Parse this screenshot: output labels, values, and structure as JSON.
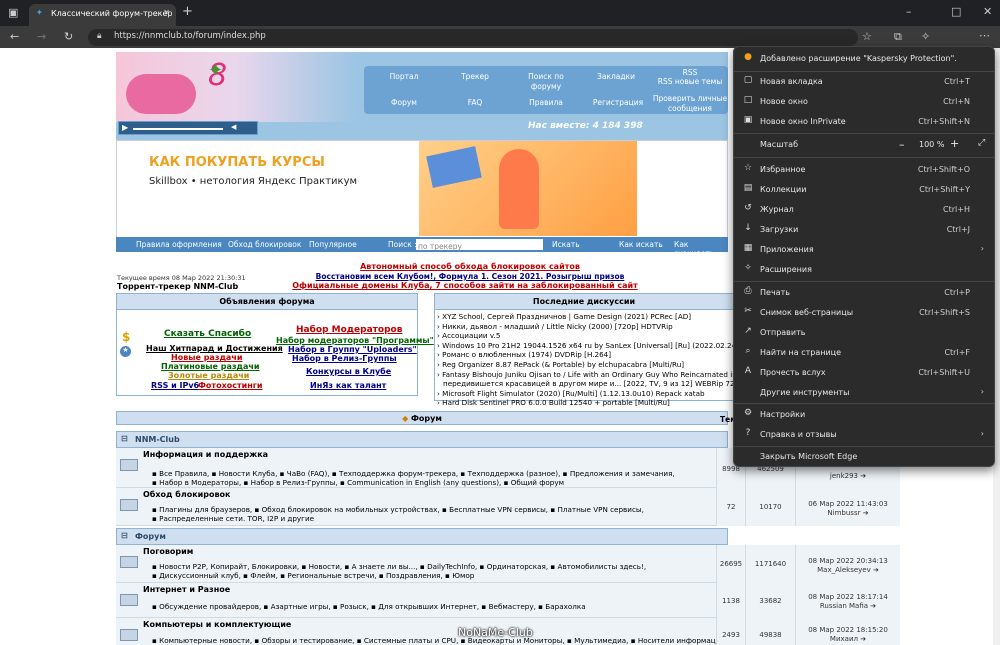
{
  "browser": {
    "tab_title": "Классический форум-трекер :: ",
    "url": "https://nnmclub.to/forum/index.php"
  },
  "site": {
    "nav_top": [
      "Портал",
      "Трекер",
      "Поиск по форуму",
      "Закладки",
      "RSS",
      "RSS новые темы"
    ],
    "nav_bottom": [
      "Форум",
      "FAQ",
      "Правила",
      "Регистрация",
      "Проверить личные сообщения"
    ],
    "online": "Нас вместе: 4 184 398",
    "ad_heading": "КАК ПОКУПАТЬ КУРСЫ",
    "ad_brands": "Skillbox   • нетология   Яндекс Практикум",
    "subnav": {
      "rules": "Правила оформления",
      "bypass": "Обход блокировок",
      "popular": "Популярное",
      "search_label": "Поиск :",
      "search_placeholder": "по трекеру",
      "search_btn": "Искать",
      "how_search": "Как искать",
      "how_download": "Как скачивать"
    },
    "time": "Текущее время 08 Мар 2022 21:30:31",
    "tracker_title": "Торрент-трекер NNM-Club",
    "announce": [
      "Автономный способ обхода блокировок сайтов",
      "Восстановим всем Клубом!, Формула 1. Сезон 2021. Розыгрыш призов",
      "Официальные домены Клуба, 7 способов зайти на заблокированный сайт"
    ],
    "announcements": {
      "title": "Объявления форума",
      "left": [
        "Сказать Спасибо",
        "Наш Хитпарад и Достижения",
        "Новые раздачи",
        "Платиновые раздачи",
        "Золотые раздачи",
        "RSS и IPv6",
        "Фотохостинги"
      ],
      "right": [
        "Набор Модераторов",
        "Набор модераторов \"Программы\"",
        "Набор в Группу \"Uploaders\"",
        "Набор в Релиз-Группы",
        "Конкурсы в Клубе",
        "ИнЯз как талант"
      ]
    },
    "discussions": {
      "title": "Последние дискуссии",
      "items": [
        "› XYZ School, Сергей Праздничнов | Game Design (2021) PCRec [AD]",
        "› Никки, дьявол - младший / Little Nicky (2000) [720p] HDTVRip",
        "› Ассоциации v.5",
        "› Windows 10 Pro 21H2 19044.1526 x64 ru by SanLex [Universal] [Ru] (2022.02.24)",
        "› Романс о влюбленных (1974) DVDRip [H.264]",
        "› Reg Organizer 8.87 RePack (& Portable) by elchupacabra [Multi/Ru]",
        "› Fantasy Bishoujo Juniku Ojisan to / Life with an Ordinary Guy Who Reincarnated into a T",
        "передивишется красавицей в другом мире и... [2022, TV, 9 из 12] WEBRip 720p raw",
        "› Microsoft Flight Simulator (2020) [Ru/Multi] (1.12.13.0u10) Repack xatab",
        "› Hard Disk Sentinel PRO 6.0.0 Build 12540 + portable [Multi/Ru]"
      ]
    },
    "forum_header": "Форум",
    "col_header": "Тем",
    "sections": [
      {
        "title": "NNM-Club",
        "forums": [
          {
            "title": "Информация и поддержка",
            "lines": [
              "▪ Все Правила, ▪ Новости Клуба, ▪ ЧаВо (FAQ), ▪ Техподдержка форум-трекера, ▪ Техподдержка (разное), ▪ Предложения и замечания,",
              "▪ Набор в Модераторы, ▪ Набор в Релиз-Группы, ▪ Communication in English (any questions), ▪ Общий форум"
            ],
            "topics": "8998",
            "posts": "462509",
            "last": [
              "",
              "jenk293 ➔"
            ]
          },
          {
            "title": "Обход блокировок",
            "lines": [
              "▪ Плагины для браузеров, ▪ Обход блокировок на мобильных устройствах, ▪ Бесплатные VPN сервисы, ▪ Платные VPN сервисы,",
              "▪ Распределенные сети. TOR, I2P и другие"
            ],
            "topics": "72",
            "posts": "10170",
            "last": [
              "06 Мар 2022 11:43:03",
              "Nimbussr ➔"
            ]
          }
        ]
      },
      {
        "title": "Форум",
        "forums": [
          {
            "title": "Поговорим",
            "lines": [
              "▪ Новости P2P, Копирайт, Блокировки, ▪ Новости, ▪ А знаете ли вы..., ▪ DailyTechInfo, ▪ Ординаторская, ▪ Автомобилисты здесь!,",
              "▪ Дискуссионный клуб, ▪ Флейм, ▪ Региональные встречи, ▪ Поздравления, ▪ Юмор"
            ],
            "topics": "26695",
            "posts": "1171640",
            "last": [
              "08 Мар 2022 20:34:13",
              "Max_Alekseyev ➔"
            ]
          },
          {
            "title": "Интернет и Разное",
            "lines": [
              "▪ Обсуждение провайдеров, ▪ Азартные игры, ▪ Розыск, ▪ Для открывших Интернет, ▪ Вебмастеру, ▪ Барахолка"
            ],
            "topics": "1138",
            "posts": "33682",
            "last": [
              "08 Мар 2022 18:17:14",
              "Russian Mafia ➔"
            ]
          },
          {
            "title": "Компьютеры и комплектующие",
            "lines": [
              "▪ Компьютерные новости, ▪ Обзоры и тестирование, ▪ Системные платы и CPU, ▪ Видеокарты и Мониторы, ▪ Мультимедиа, ▪ Носители информации,"
            ],
            "topics": "2493",
            "posts": "49838",
            "last": [
              "08 Мар 2022 18:15:20",
              "Михаил ➔"
            ]
          }
        ]
      }
    ]
  },
  "menu": {
    "notice": "Добавлено расширение \"Kaspersky Protection\".",
    "items": [
      {
        "icon": "▢",
        "label": "Новая вкладка",
        "shortcut": "Ctrl+T"
      },
      {
        "icon": "□",
        "label": "Новое окно",
        "shortcut": "Ctrl+N"
      },
      {
        "icon": "▣",
        "label": "Новое окно InPrivate",
        "shortcut": "Ctrl+Shift+N"
      }
    ],
    "zoom": {
      "label": "Масштаб",
      "value": "100 %"
    },
    "items2": [
      {
        "icon": "☆",
        "label": "Избранное",
        "shortcut": "Ctrl+Shift+O"
      },
      {
        "icon": "▤",
        "label": "Коллекции",
        "shortcut": "Ctrl+Shift+Y"
      },
      {
        "icon": "↺",
        "label": "Журнал",
        "shortcut": "Ctrl+H"
      },
      {
        "icon": "↓",
        "label": "Загрузки",
        "shortcut": "Ctrl+J"
      },
      {
        "icon": "▦",
        "label": "Приложения",
        "shortcut": "",
        "arrow": "›"
      },
      {
        "icon": "✧",
        "label": "Расширения",
        "shortcut": ""
      }
    ],
    "items3": [
      {
        "icon": "⎙",
        "label": "Печать",
        "shortcut": "Ctrl+P"
      },
      {
        "icon": "✂",
        "label": "Снимок веб-страницы",
        "shortcut": "Ctrl+Shift+S"
      },
      {
        "icon": "↗",
        "label": "Отправить",
        "shortcut": ""
      },
      {
        "icon": "⌕",
        "label": "Найти на странице",
        "shortcut": "Ctrl+F"
      },
      {
        "icon": "A",
        "label": "Прочесть вслух",
        "shortcut": "Ctrl+Shift+U"
      },
      {
        "icon": "",
        "label": "Другие инструменты",
        "shortcut": "",
        "arrow": "›"
      }
    ],
    "items4": [
      {
        "icon": "⚙",
        "label": "Настройки",
        "shortcut": ""
      },
      {
        "icon": "?",
        "label": "Справка и отзывы",
        "shortcut": "",
        "arrow": "›"
      }
    ],
    "close": "Закрыть Microsoft Edge"
  },
  "watermark": "NoNaMe-Club"
}
